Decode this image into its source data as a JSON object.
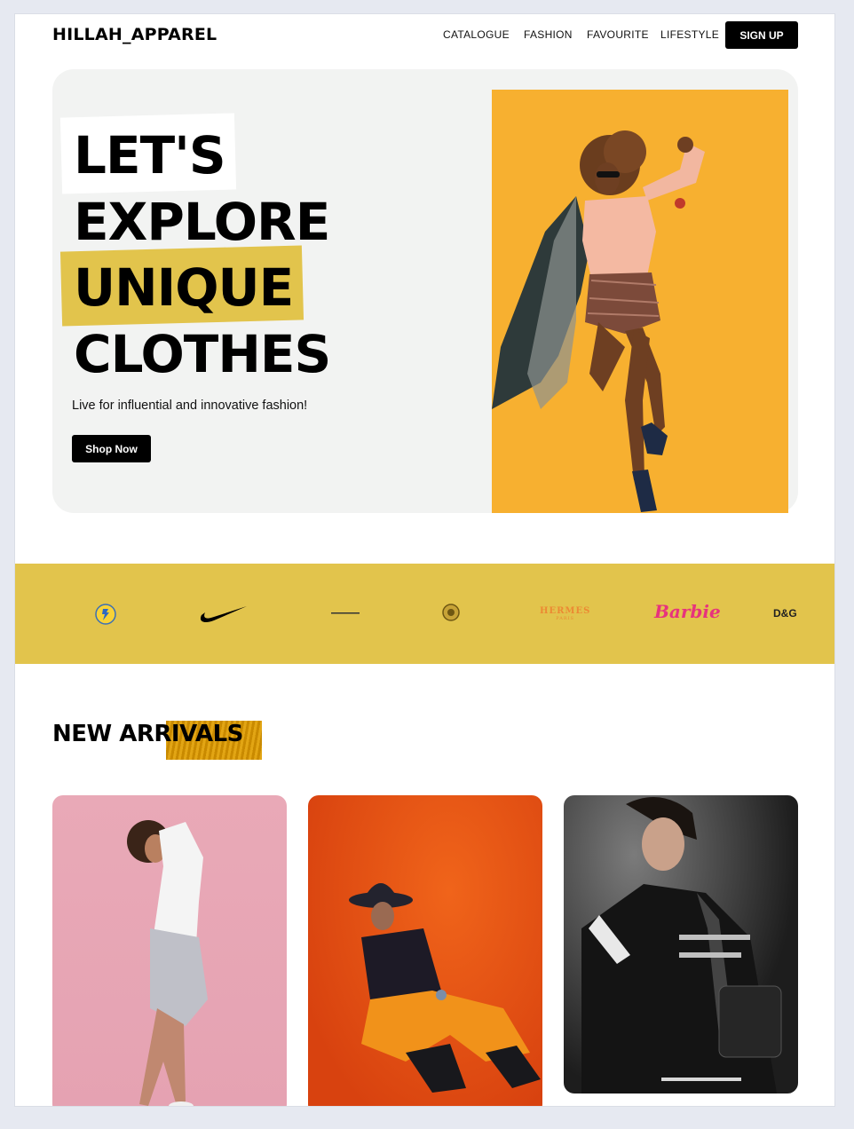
{
  "brand": "HILLAH_APPAREL",
  "nav": {
    "items": [
      "CATALOGUE",
      "FASHION",
      "FAVOURITE",
      "LIFESTYLE"
    ],
    "signup_label": "SIGN UP"
  },
  "hero": {
    "lines": [
      "LET'S",
      "EXPLORE",
      "UNIQUE",
      "CLOTHES"
    ],
    "tagline": "Live for influential and innovative fashion!",
    "cta_label": "Shop Now"
  },
  "brand_logos": {
    "nike_icon": "nike-swoosh-icon",
    "hermes_text": "HERMES",
    "hermes_sub": "PARIS",
    "barbie_text": "Barbie",
    "dg_text": "D&G"
  },
  "arrivals": {
    "heading": "NEW ARRIVALS"
  },
  "colors": {
    "accent": "#e2c44c",
    "black": "#000000",
    "hero_bg": "#f2f3f2",
    "photo_bg": "#f7b030",
    "page_bg": "#e6e9f1"
  }
}
